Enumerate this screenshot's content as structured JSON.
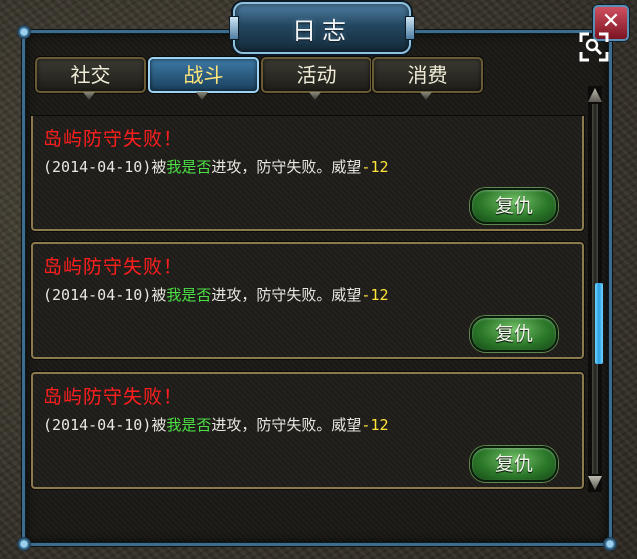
{
  "window": {
    "title": "日志",
    "close_glyph": "✕"
  },
  "tabs": [
    {
      "label": "社交",
      "active": false
    },
    {
      "label": "战斗",
      "active": true
    },
    {
      "label": "活动",
      "active": false
    },
    {
      "label": "消费",
      "active": false
    }
  ],
  "entries": [
    {
      "title": "岛屿防守失败！",
      "date": "(2014-04-10)",
      "prefix": "被",
      "attacker": "我是否",
      "result": "进攻，防守失败。威望",
      "change": "-12",
      "action": "复仇"
    },
    {
      "title": "岛屿防守失败！",
      "date": "(2014-04-10)",
      "prefix": "被",
      "attacker": "我是否",
      "result": "进攻，防守失败。威望",
      "change": "-12",
      "action": "复仇"
    },
    {
      "title": "岛屿防守失败！",
      "date": "(2014-04-10)",
      "prefix": "被",
      "attacker": "我是否",
      "result": "进攻，防守失败。威望",
      "change": "-12",
      "action": "复仇"
    }
  ],
  "scrollbar": {
    "position": 0.62,
    "visible_fraction": 0.22
  },
  "colors": {
    "frame": "#3d6d8c",
    "active_tab": "#3d7aa6",
    "entry_title": "#ff1e1e",
    "attacker_name": "#4be045",
    "value": "#ffe23a",
    "revenge_button": "#2c7a2a"
  },
  "icons": {
    "close": "close-icon",
    "zoom": "magnifier-icon"
  }
}
